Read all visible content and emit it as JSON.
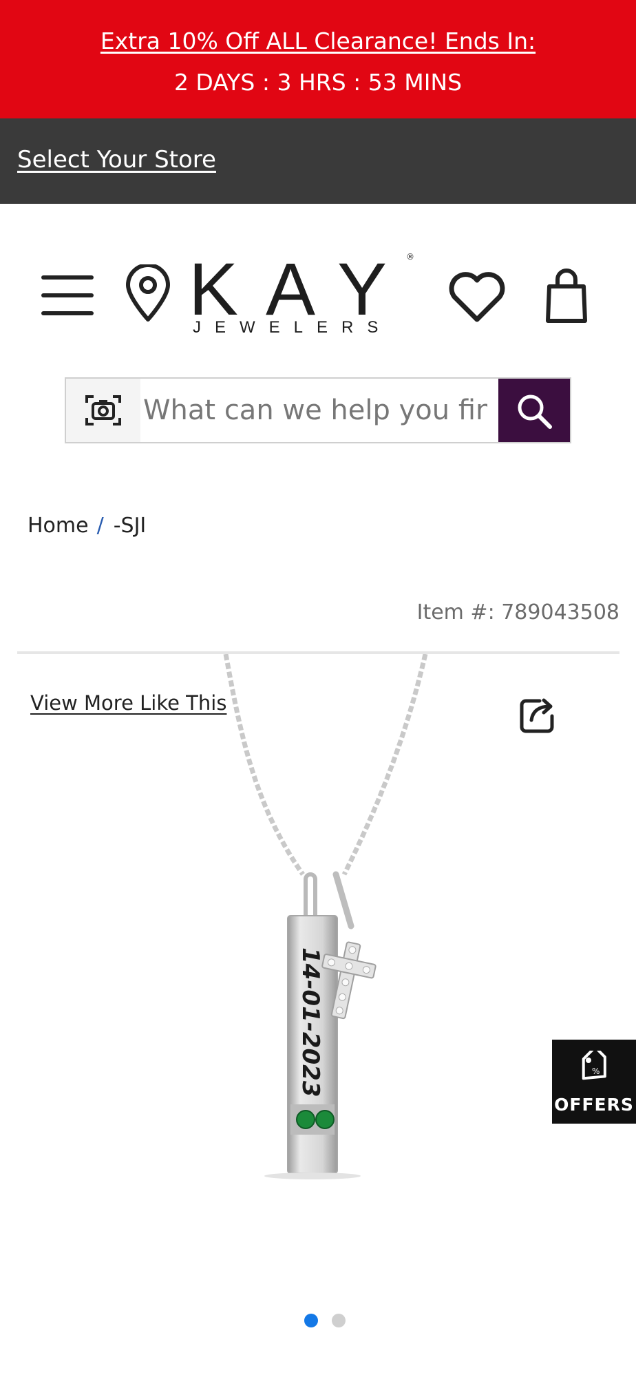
{
  "promo": {
    "headline": "Extra 10% Off ALL Clearance! Ends In:",
    "countdown": "2 DAYS : 3  HRS : 53 MINS",
    "background": "#e10613"
  },
  "store_bar": {
    "link": "Select Your Store"
  },
  "header": {
    "logo_main": "KAY",
    "logo_sub": "JEWELERS",
    "logo_reg": "®",
    "icons": [
      "menu-icon",
      "location-pin-icon",
      "heart-icon",
      "shopping-bag-icon"
    ]
  },
  "search": {
    "placeholder": "What can we help you find?",
    "button_color": "#3b0e3f",
    "icons": [
      "camera-search-icon",
      "search-icon"
    ]
  },
  "breadcrumb": {
    "home": "Home",
    "separator": "/",
    "current": "-SJI"
  },
  "product": {
    "item_number": "Item #: 789043508",
    "view_more": "View More Like This",
    "engraving": "14-01-2023"
  },
  "offers": {
    "label": "OFFERS"
  },
  "carousel": {
    "total": 2,
    "active": 1,
    "active_color": "#1478e6"
  }
}
